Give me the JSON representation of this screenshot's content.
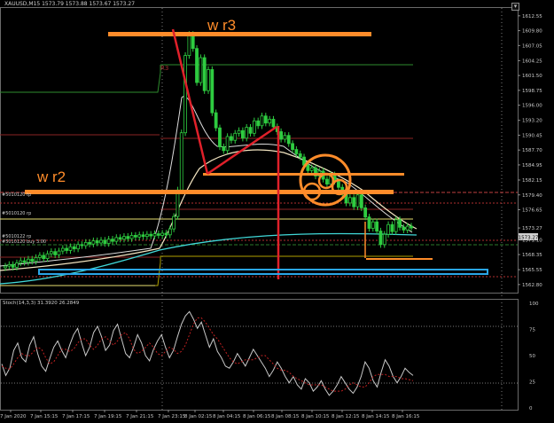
{
  "window": {
    "symbol_title": "XAUUSD,M15",
    "ohlc": "1573.79 1573.88 1573.67 1573.27"
  },
  "annotations": {
    "wr3": "w r3",
    "wr2": "w r2",
    "r3_tag": "R3"
  },
  "price_lines": [
    {
      "label": "#5010120 tp"
    },
    {
      "label": "#5010120 rp"
    },
    {
      "label": "#5010122 rp"
    },
    {
      "label": "#5010120 buy 3.00"
    }
  ],
  "stoch": {
    "label": "Stoch(14,3,3) 31.3920 26.2849"
  },
  "colors": {
    "background": "#000000",
    "candle": "#2ecc40",
    "annotation": "#ff8c2a",
    "red_line": "#e0202a",
    "cyan_ma": "#40d8d8",
    "blue_zone": "#2aa6e8"
  },
  "chart_data": {
    "type": "candlestick",
    "price_axis": {
      "ticks": [
        "1612.55",
        "1609.80",
        "1607.05",
        "1604.25",
        "1601.50",
        "1598.75",
        "1596.00",
        "1593.20",
        "1590.45",
        "1587.70",
        "1584.95",
        "1582.15",
        "1579.40",
        "1576.65",
        "1573.27",
        "1571.10",
        "1568.35",
        "1565.55",
        "1562.80"
      ],
      "range": [
        1561.3,
        1614.0
      ],
      "current_price": "1573.27"
    },
    "stoch_axis": {
      "ticks": [
        "100",
        "75",
        "50",
        "25",
        "0"
      ],
      "range": [
        0,
        100
      ]
    },
    "time_axis": [
      "7 Jan 2020",
      "7 Jan 15:15",
      "7 Jan 17:15",
      "7 Jan 19:15",
      "7 Jan 21:15",
      "7 Jan 23:15",
      "8 Jan 02:15",
      "8 Jan 04:15",
      "8 Jan 06:15",
      "8 Jan 08:15",
      "8 Jan 10:15",
      "8 Jan 12:15",
      "8 Jan 14:15",
      "8 Jan 16:15"
    ],
    "candles_close": [
      1566.2,
      1566.5,
      1566.0,
      1566.8,
      1567.2,
      1566.9,
      1567.5,
      1567.1,
      1567.8,
      1568.2,
      1567.6,
      1568.5,
      1568.9,
      1568.3,
      1569.0,
      1569.5,
      1569.1,
      1569.8,
      1569.4,
      1570.2,
      1570.0,
      1570.6,
      1570.3,
      1570.9,
      1570.5,
      1571.0,
      1570.4,
      1571.2,
      1570.8,
      1571.5,
      1571.2,
      1571.7,
      1571.3,
      1571.9,
      1571.6,
      1572.0,
      1571.7,
      1572.1,
      1571.8,
      1572.2,
      1571.9,
      1572.3,
      1572.0,
      1573.1,
      1575.4,
      1580.3,
      1590.9,
      1605.2,
      1609.1,
      1606.5,
      1600.2,
      1604.8,
      1598.7,
      1602.6,
      1594.6,
      1591.8,
      1588.3,
      1587.6,
      1590.2,
      1589.5,
      1590.8,
      1591.3,
      1589.9,
      1591.9,
      1590.8,
      1593.1,
      1592.2,
      1594.0,
      1592.7,
      1593.4,
      1592.0,
      1591.1,
      1589.7,
      1590.4,
      1588.9,
      1587.8,
      1587.0,
      1586.4,
      1584.9,
      1583.9,
      1584.4,
      1582.9,
      1583.8,
      1582.3,
      1581.4,
      1583.1,
      1581.9,
      1580.8,
      1579.5,
      1577.9,
      1578.9,
      1577.2,
      1579.4,
      1577.0,
      1575.3,
      1573.2,
      1574.4,
      1572.7,
      1570.2,
      1572.1,
      1573.9,
      1572.6,
      1574.8,
      1573.4,
      1572.9,
      1573.6,
      1573.27
    ],
    "stoch_k": [
      42,
      31,
      38,
      55,
      62,
      48,
      44,
      60,
      68,
      52,
      40,
      35,
      47,
      58,
      64,
      55,
      48,
      60,
      70,
      76,
      62,
      50,
      58,
      72,
      78,
      68,
      55,
      60,
      74,
      80,
      66,
      52,
      48,
      58,
      70,
      62,
      50,
      45,
      56,
      64,
      70,
      58,
      48,
      55,
      68,
      80,
      88,
      92,
      85,
      76,
      82,
      70,
      58,
      66,
      54,
      48,
      40,
      38,
      44,
      52,
      46,
      40,
      48,
      56,
      50,
      44,
      38,
      30,
      36,
      44,
      38,
      30,
      24,
      30,
      22,
      18,
      28,
      24,
      16,
      20,
      26,
      18,
      12,
      16,
      22,
      30,
      24,
      18,
      14,
      20,
      30,
      44,
      38,
      26,
      20,
      34,
      46,
      40,
      30,
      24,
      30,
      38,
      34,
      31
    ],
    "stoch_d": [
      40,
      38,
      37,
      42,
      48,
      52,
      50,
      50,
      54,
      58,
      56,
      48,
      42,
      44,
      50,
      56,
      56,
      54,
      56,
      62,
      66,
      66,
      60,
      56,
      60,
      66,
      68,
      64,
      60,
      64,
      70,
      72,
      66,
      56,
      52,
      54,
      58,
      62,
      58,
      52,
      50,
      54,
      58,
      56,
      52,
      54,
      60,
      70,
      80,
      86,
      86,
      82,
      76,
      70,
      66,
      60,
      54,
      48,
      44,
      42,
      44,
      46,
      46,
      46,
      48,
      50,
      50,
      46,
      42,
      38,
      36,
      36,
      34,
      30,
      28,
      26,
      24,
      22,
      22,
      22,
      22,
      20,
      18,
      16,
      16,
      16,
      18,
      22,
      24,
      22,
      20,
      20,
      24,
      30,
      32,
      32,
      32,
      30,
      30,
      30,
      28,
      28,
      27,
      26
    ]
  }
}
